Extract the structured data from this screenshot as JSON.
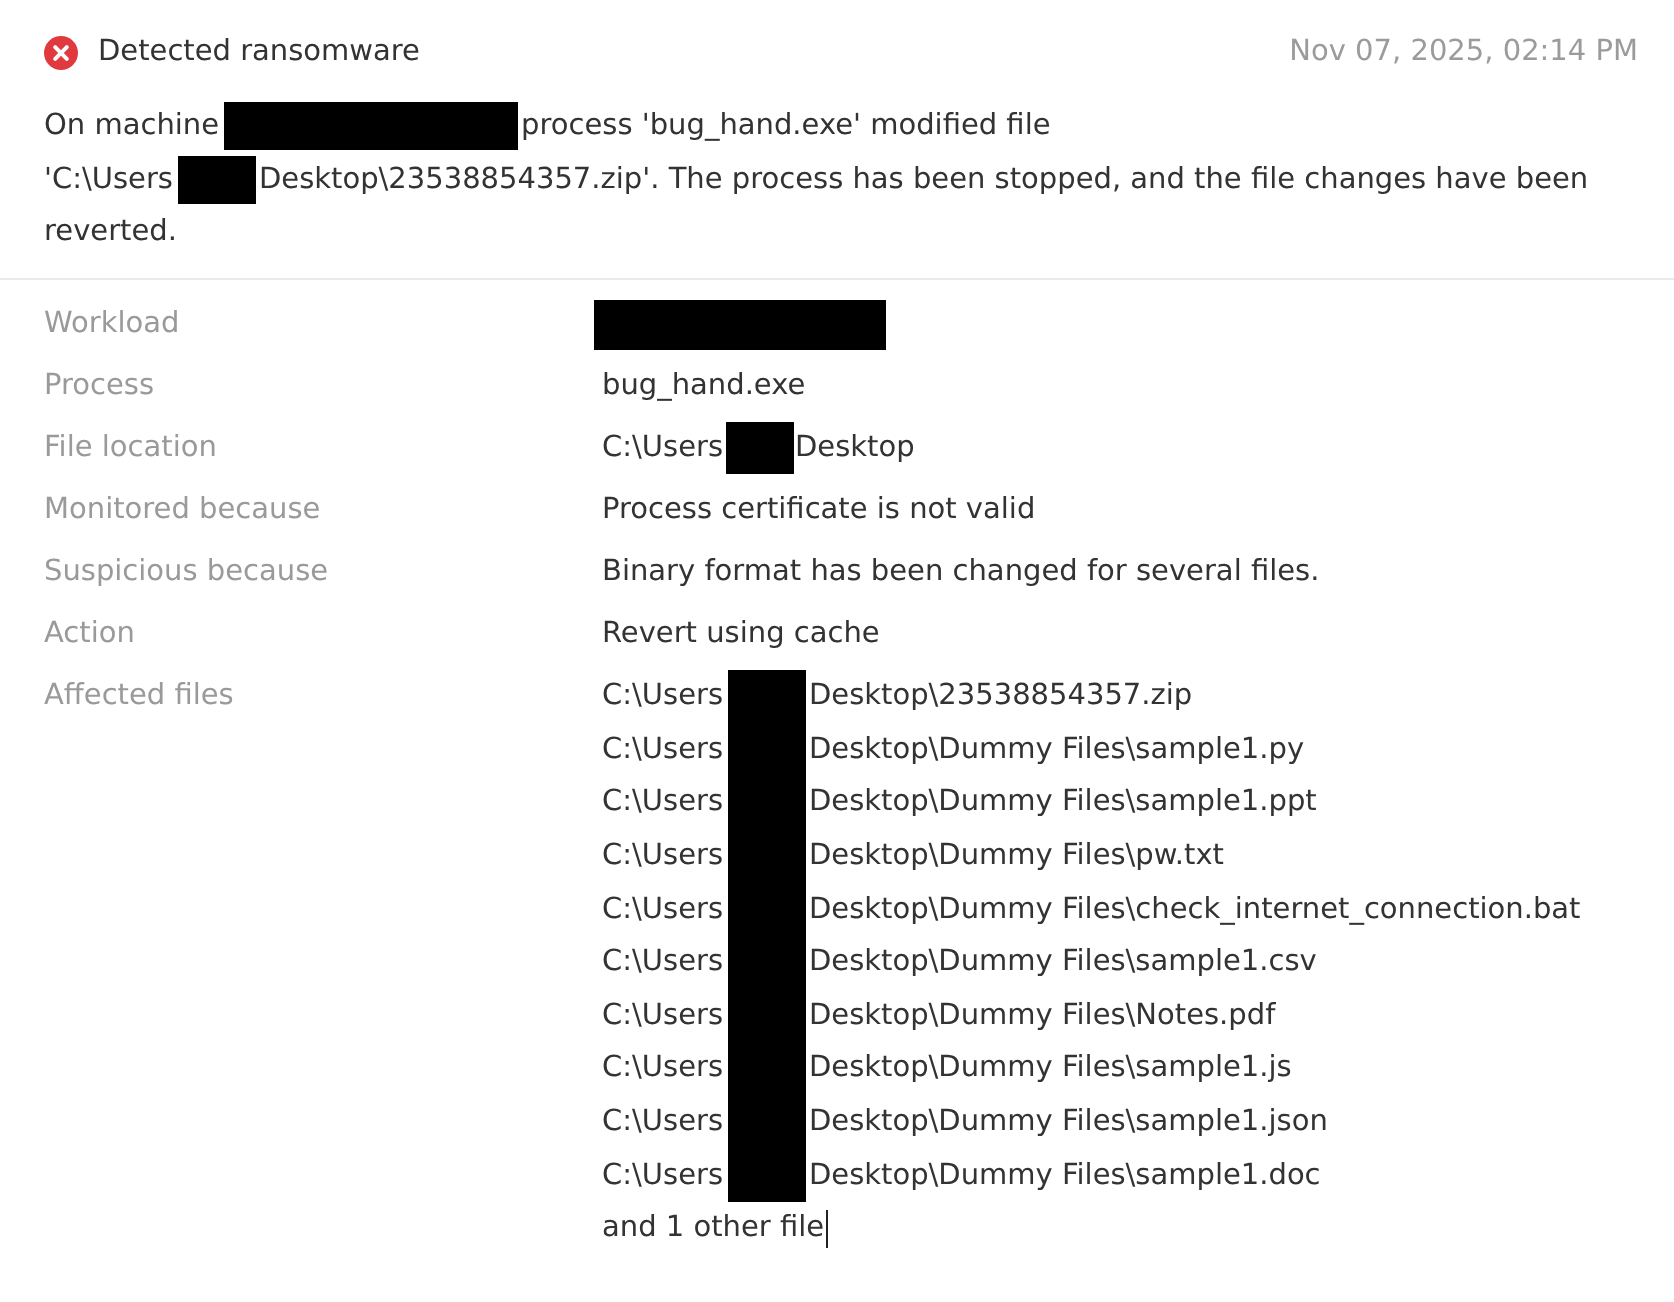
{
  "alert": {
    "title": "Detected ransomware",
    "timestamp": "Nov 07, 2025, 02:14 PM"
  },
  "message": {
    "lines": [
      [
        {
          "kind": "text",
          "text": "On machine"
        },
        {
          "kind": "redaction-long"
        },
        {
          "kind": "text",
          "text": "process 'bug_hand.exe' modified file"
        }
      ],
      [
        {
          "kind": "text",
          "text": "'C:\\Users"
        },
        {
          "kind": "redaction-short"
        },
        {
          "kind": "text",
          "text": "Desktop\\23538854357.zip'. The process has been stopped, and the file changes have been"
        }
      ],
      [
        {
          "kind": "text",
          "text": "reverted."
        }
      ]
    ]
  },
  "details": [
    {
      "label": "Workload",
      "kind": "redacted"
    },
    {
      "label": "Process",
      "kind": "text",
      "value": "bug_hand.exe"
    },
    {
      "label": "File location",
      "kind": "path",
      "before": "C:\\Users",
      "after": "Desktop"
    },
    {
      "label": "Monitored because",
      "kind": "text",
      "value": "Process certificate is not valid"
    },
    {
      "label": "Suspicious because",
      "kind": "text",
      "value": "Binary format has been changed for several files."
    },
    {
      "label": "Action",
      "kind": "text",
      "value": "Revert using cache"
    },
    {
      "label": "Affected files",
      "kind": "file-list",
      "files": [
        {
          "before": "C:\\Users",
          "after": "Desktop\\23538854357.zip"
        },
        {
          "before": "C:\\Users",
          "after": "Desktop\\Dummy Files\\sample1.py"
        },
        {
          "before": "C:\\Users",
          "after": "Desktop\\Dummy Files\\sample1.ppt"
        },
        {
          "before": "C:\\Users",
          "after": "Desktop\\Dummy Files\\pw.txt"
        },
        {
          "before": "C:\\Users",
          "after": "Desktop\\Dummy Files\\check_internet_connection.bat"
        },
        {
          "before": "C:\\Users",
          "after": "Desktop\\Dummy Files\\sample1.csv"
        },
        {
          "before": "C:\\Users",
          "after": "Desktop\\Dummy Files\\Notes.pdf"
        },
        {
          "before": "C:\\Users",
          "after": "Desktop\\Dummy Files\\sample1.js"
        },
        {
          "before": "C:\\Users",
          "after": "Desktop\\Dummy Files\\sample1.json"
        },
        {
          "before": "C:\\Users",
          "after": "Desktop\\Dummy Files\\sample1.doc"
        }
      ],
      "more": "and 1 other file"
    }
  ]
}
